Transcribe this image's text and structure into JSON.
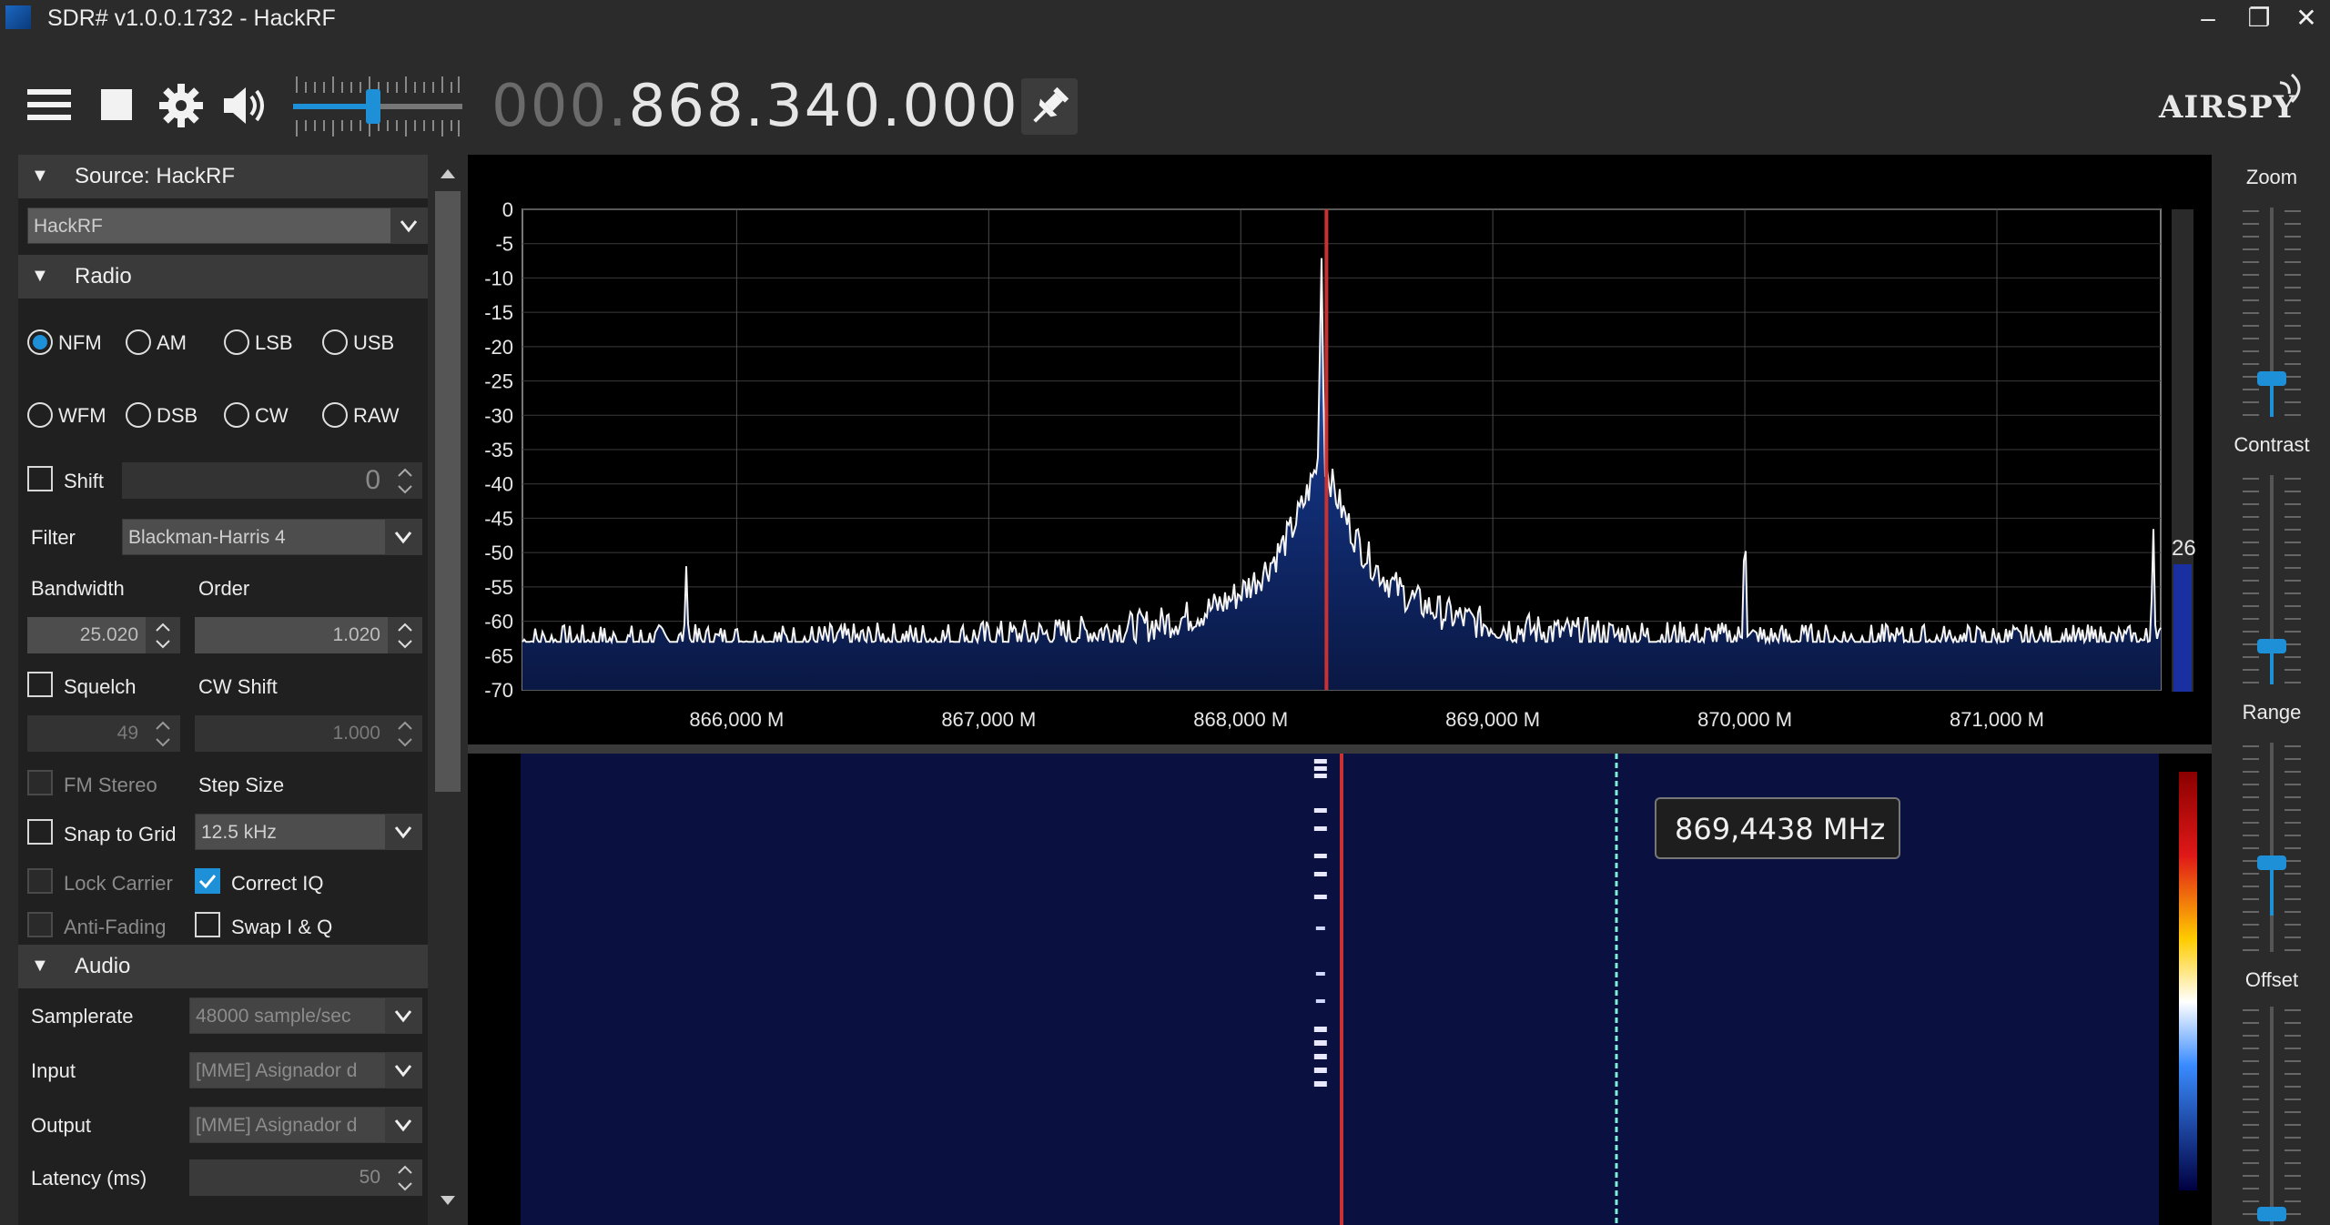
{
  "window": {
    "title": "SDR# v1.0.0.1732 - HackRF",
    "minimize": "–",
    "restore": "❐",
    "close": "✕"
  },
  "toolbar": {
    "freq_dim": "000.",
    "freq_lit": "868.340.000",
    "brand": "AIRSPY"
  },
  "source": {
    "header": "Source: HackRF",
    "device": "HackRF"
  },
  "radio": {
    "header": "Radio",
    "modes": [
      {
        "label": "NFM",
        "selected": true
      },
      {
        "label": "AM",
        "selected": false
      },
      {
        "label": "LSB",
        "selected": false
      },
      {
        "label": "USB",
        "selected": false
      },
      {
        "label": "WFM",
        "selected": false
      },
      {
        "label": "DSB",
        "selected": false
      },
      {
        "label": "CW",
        "selected": false
      },
      {
        "label": "RAW",
        "selected": false
      }
    ],
    "shift_label": "Shift",
    "shift_value": "0",
    "filter_label": "Filter",
    "filter_value": "Blackman-Harris 4",
    "bandwidth_label": "Bandwidth",
    "order_label": "Order",
    "bandwidth_value": "25.020",
    "order_value": "1.020",
    "squelch_label": "Squelch",
    "cwshift_label": "CW Shift",
    "squelch_value": "49",
    "cwshift_value": "1.000",
    "fmstereo_label": "FM Stereo",
    "stepsize_label": "Step Size",
    "snap_label": "Snap to Grid",
    "stepsize_value": "12.5 kHz",
    "lockcarrier_label": "Lock Carrier",
    "correctiq_label": "Correct IQ",
    "antifading_label": "Anti-Fading",
    "swapiq_label": "Swap I & Q"
  },
  "audio": {
    "header": "Audio",
    "samplerate_label": "Samplerate",
    "samplerate_value": "48000 sample/sec",
    "input_label": "Input",
    "input_value": "[MME] Asignador d",
    "output_label": "Output",
    "output_value": "[MME] Asignador d",
    "latency_label": "Latency (ms)",
    "latency_value": "50"
  },
  "right": {
    "zoom": "Zoom",
    "contrast": "Contrast",
    "range": "Range",
    "offset": "Offset",
    "level": "26"
  },
  "tooltip": "869,4438 MHz",
  "colors": {
    "accent": "#1e90d8",
    "tuning_line": "#c83232",
    "waterfall_bg": "#0a1040"
  },
  "chart_data": {
    "type": "line",
    "x_ticks": [
      "866,000 M",
      "867,000 M",
      "868,000 M",
      "869,000 M",
      "870,000 M",
      "871,000 M"
    ],
    "y_ticks": [
      "0",
      "-5",
      "-10",
      "-15",
      "-20",
      "-25",
      "-30",
      "-35",
      "-40",
      "-45",
      "-50",
      "-55",
      "-60",
      "-65",
      "-70"
    ],
    "xlim": [
      865.15,
      871.65
    ],
    "ylim": [
      -70,
      0
    ],
    "center_frequency_mhz": 868.34,
    "noise_floor_db": -63,
    "peaks": [
      {
        "x": 865.8,
        "y": -52
      },
      {
        "x": 868.32,
        "y": -7
      },
      {
        "x": 870.0,
        "y": -45
      },
      {
        "x": 871.62,
        "y": -46
      }
    ]
  }
}
